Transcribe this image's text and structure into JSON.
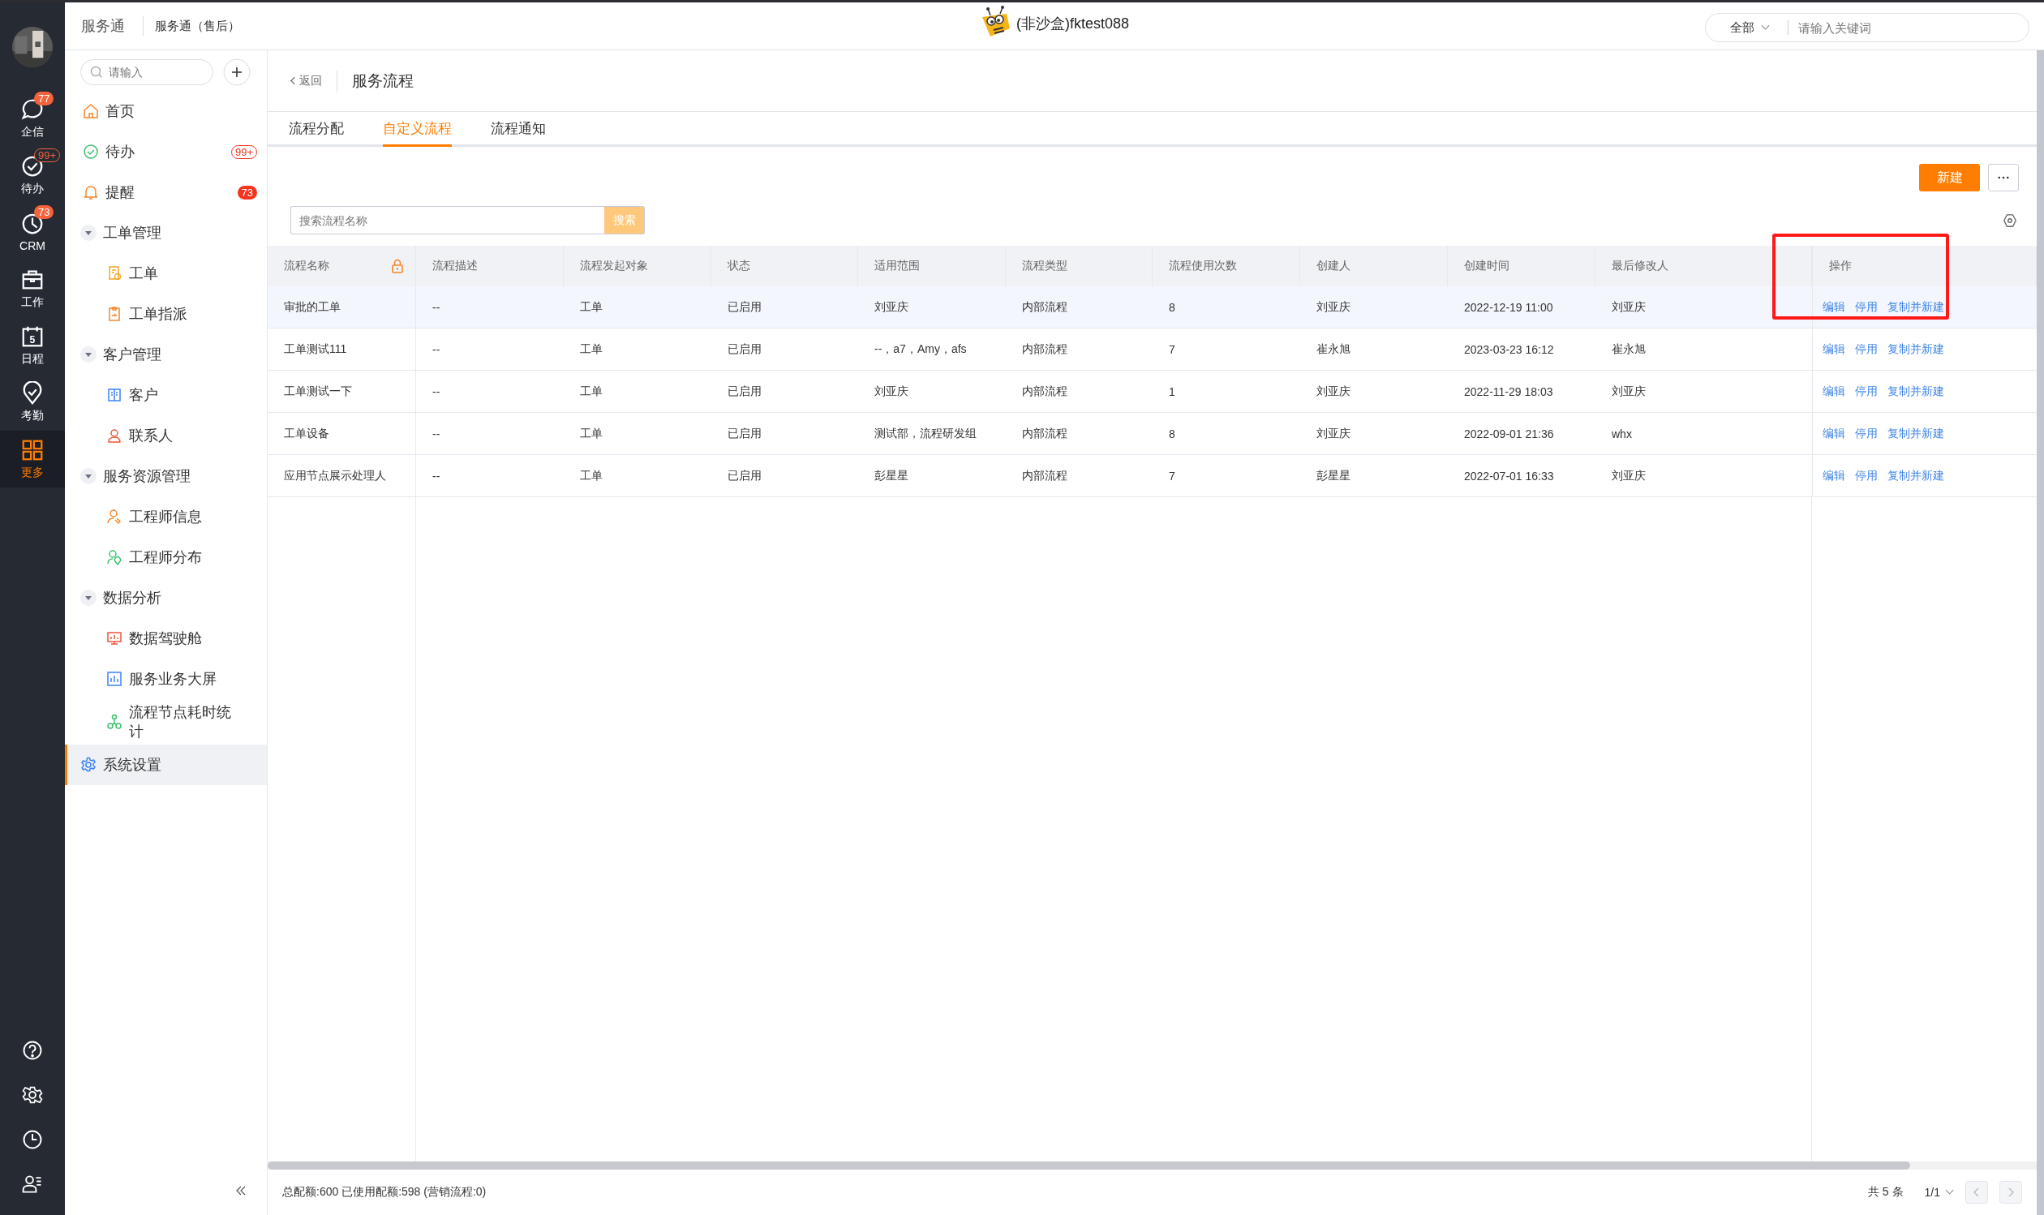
{
  "rail": {
    "items": [
      {
        "label": "企信",
        "badge": {
          "text": "77",
          "kind": "solid"
        },
        "selected": false
      },
      {
        "label": "待办",
        "badge": {
          "text": "99+",
          "kind": "outline"
        },
        "selected": false
      },
      {
        "label": "CRM",
        "badge": {
          "text": "73",
          "kind": "solid"
        },
        "selected": false
      },
      {
        "label": "工作",
        "selected": false
      },
      {
        "label": "日程",
        "icon_text": "5",
        "selected": false
      },
      {
        "label": "考勤",
        "selected": false
      },
      {
        "label": "更多",
        "selected": true
      }
    ]
  },
  "topbar": {
    "app": "服务通",
    "module": "服务通（售后）",
    "account": "(非沙盒)fktest088",
    "scope": "全部",
    "search_placeholder": "请输入关键词"
  },
  "sidebar": {
    "search_placeholder": "请输入",
    "items": [
      {
        "label": "首页",
        "selected": false
      },
      {
        "label": "待办",
        "badge": {
          "text": "99+",
          "kind": "outline"
        },
        "selected": false
      },
      {
        "label": "提醒",
        "badge": {
          "text": "73",
          "kind": "solid"
        },
        "selected": false
      },
      {
        "label": "工单管理",
        "expanded": true,
        "children": [
          {
            "label": "工单",
            "selected": false
          },
          {
            "label": "工单指派",
            "selected": false
          }
        ]
      },
      {
        "label": "客户管理",
        "expanded": true,
        "children": [
          {
            "label": "客户",
            "selected": false
          },
          {
            "label": "联系人",
            "selected": false
          }
        ]
      },
      {
        "label": "服务资源管理",
        "expanded": true,
        "children": [
          {
            "label": "工程师信息",
            "selected": false
          },
          {
            "label": "工程师分布",
            "selected": false
          }
        ]
      },
      {
        "label": "数据分析",
        "expanded": true,
        "children": [
          {
            "label": "数据驾驶舱",
            "selected": false
          },
          {
            "label": "服务业务大屏",
            "selected": false
          },
          {
            "label": "流程节点耗时统计",
            "selected": false
          }
        ]
      },
      {
        "label": "系统设置",
        "selected": true
      }
    ]
  },
  "page": {
    "back": "返回",
    "title": "服务流程",
    "tabs": [
      {
        "label": "流程分配",
        "selected": false
      },
      {
        "label": "自定义流程",
        "selected": true
      },
      {
        "label": "流程通知",
        "selected": false
      }
    ],
    "new_button": "新建",
    "search_placeholder": "搜索流程名称",
    "search_button": "搜索",
    "table": {
      "columns": [
        "流程名称",
        "流程描述",
        "流程发起对象",
        "状态",
        "适用范围",
        "流程类型",
        "流程使用次数",
        "创建人",
        "创建时间",
        "最后修改人",
        "操作"
      ],
      "rows": [
        {
          "selected": true,
          "cells": [
            "审批的工单",
            "--",
            "工单",
            "已启用",
            "刘亚庆",
            "内部流程",
            "8",
            "刘亚庆",
            "2022-12-19 11:00",
            "刘亚庆"
          ],
          "actions": [
            "编辑",
            "停用",
            "复制并新建"
          ]
        },
        {
          "selected": false,
          "cells": [
            "工单测试111",
            "--",
            "工单",
            "已启用",
            "--，a7，Amy，afs",
            "内部流程",
            "7",
            "崔永旭",
            "2023-03-23 16:12",
            "崔永旭"
          ],
          "actions": [
            "编辑",
            "停用",
            "复制并新建"
          ]
        },
        {
          "selected": false,
          "cells": [
            "工单测试一下",
            "--",
            "工单",
            "已启用",
            "刘亚庆",
            "内部流程",
            "1",
            "刘亚庆",
            "2022-11-29 18:03",
            "刘亚庆"
          ],
          "actions": [
            "编辑",
            "停用",
            "复制并新建"
          ]
        },
        {
          "selected": false,
          "cells": [
            "工单设备",
            "--",
            "工单",
            "已启用",
            "测试部，流程研发组",
            "内部流程",
            "8",
            "刘亚庆",
            "2022-09-01 21:36",
            "whx"
          ],
          "actions": [
            "编辑",
            "停用",
            "复制并新建"
          ]
        },
        {
          "selected": false,
          "cells": [
            "应用节点展示处理人",
            "--",
            "工单",
            "已启用",
            "彭星星",
            "内部流程",
            "7",
            "彭星星",
            "2022-07-01 16:33",
            "刘亚庆"
          ],
          "actions": [
            "编辑",
            "停用",
            "复制并新建"
          ]
        }
      ]
    },
    "footer": {
      "quota": "总配额:600 已使用配额:598 (营销流程:0)",
      "total": "共 5 条",
      "page": "1/1"
    }
  }
}
